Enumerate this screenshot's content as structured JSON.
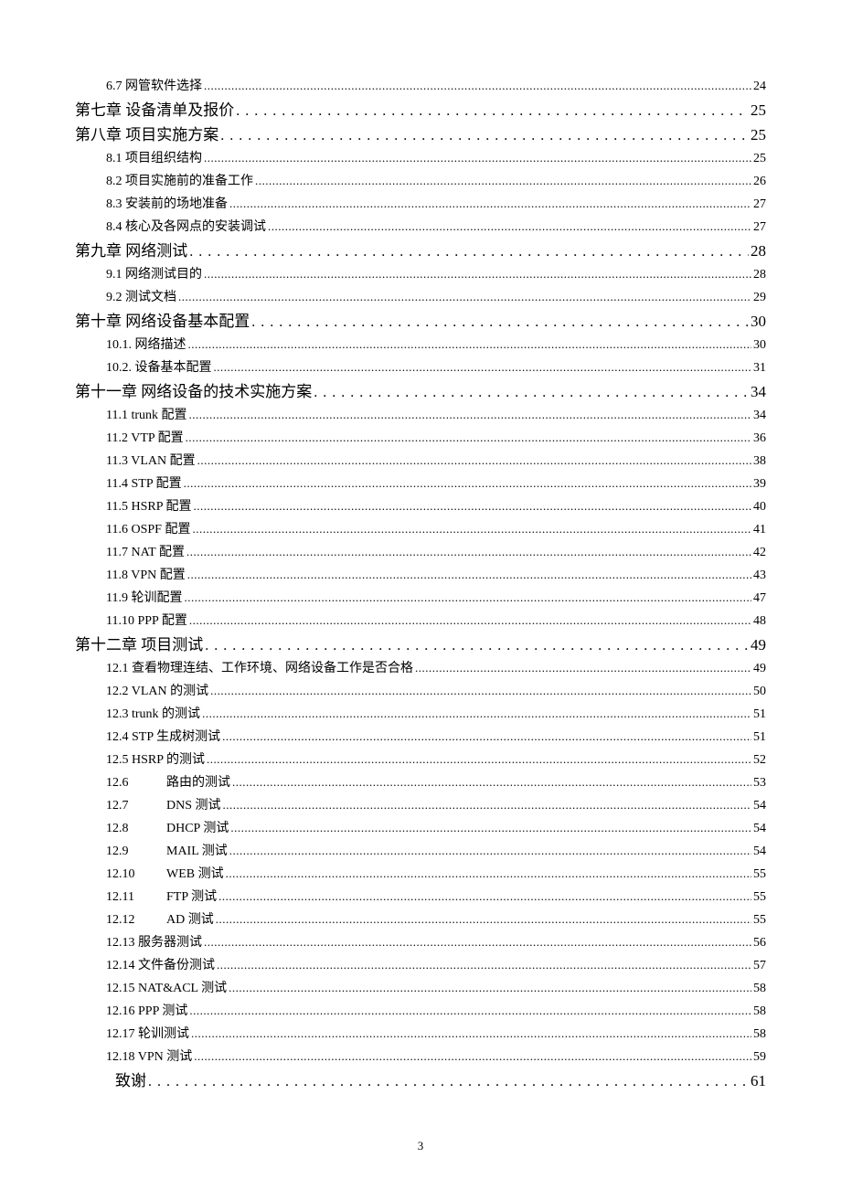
{
  "page_number": "3",
  "toc": [
    {
      "level": 2,
      "label": "6.7 网管软件选择",
      "page": "24"
    },
    {
      "level": 1,
      "label": "第七章 设备清单及报价",
      "page": "25"
    },
    {
      "level": 1,
      "label": "第八章 项目实施方案",
      "page": "25"
    },
    {
      "level": 2,
      "label": "8.1 项目组织结构",
      "page": "25"
    },
    {
      "level": 2,
      "label": "8.2 项目实施前的准备工作",
      "page": "26"
    },
    {
      "level": 2,
      "label": "8.3 安装前的场地准备",
      "page": "27"
    },
    {
      "level": 2,
      "label": "8.4 核心及各网点的安装调试",
      "page": "27"
    },
    {
      "level": 1,
      "label": "第九章 网络测试",
      "page": "28"
    },
    {
      "level": 2,
      "label": "9.1 网络测试目的",
      "page": "28"
    },
    {
      "level": 2,
      "label": "9.2 测试文档",
      "page": "29"
    },
    {
      "level": 1,
      "label": "第十章 网络设备基本配置",
      "page": "30"
    },
    {
      "level": 2,
      "label": "10.1. 网络描述",
      "page": "30"
    },
    {
      "level": 2,
      "label": "10.2. 设备基本配置",
      "page": "31"
    },
    {
      "level": 1,
      "label": "第十一章 网络设备的技术实施方案",
      "page": "34"
    },
    {
      "level": 2,
      "label": "11.1 trunk 配置",
      "page": "34"
    },
    {
      "level": 2,
      "label": "11.2 VTP 配置",
      "page": "36"
    },
    {
      "level": 2,
      "label": "11.3 VLAN 配置",
      "page": "38"
    },
    {
      "level": 2,
      "label": "11.4 STP 配置",
      "page": "39"
    },
    {
      "level": 2,
      "label": "11.5 HSRP 配置",
      "page": "40"
    },
    {
      "level": 2,
      "label": "11.6 OSPF 配置",
      "page": "41"
    },
    {
      "level": 2,
      "label": "11.7 NAT 配置",
      "page": "42"
    },
    {
      "level": 2,
      "label": "11.8 VPN 配置",
      "page": "43"
    },
    {
      "level": 2,
      "label": "11.9 轮训配置",
      "page": "47"
    },
    {
      "level": 2,
      "label": "11.10 PPP 配置",
      "page": "48"
    },
    {
      "level": 1,
      "label": "第十二章 项目测试",
      "page": "49"
    },
    {
      "level": 2,
      "label": "12.1 查看物理连结、工作环境、网络设备工作是否合格",
      "page": "49"
    },
    {
      "level": 2,
      "label": "12.2 VLAN 的测试",
      "page": "50"
    },
    {
      "level": 2,
      "label": "12.3 trunk 的测试",
      "page": "51"
    },
    {
      "level": 2,
      "label": "12.4 STP 生成树测试",
      "page": "51"
    },
    {
      "level": 2,
      "label": "12.5 HSRP 的测试",
      "page": "52"
    },
    {
      "level": 2,
      "pad": true,
      "num": "12.6",
      "rest": "路由的测试",
      "page": "53"
    },
    {
      "level": 2,
      "pad": true,
      "num": "12.7",
      "rest": "DNS 测试",
      "page": "54"
    },
    {
      "level": 2,
      "pad": true,
      "num": "12.8",
      "rest": "DHCP 测试",
      "page": "54"
    },
    {
      "level": 2,
      "pad": true,
      "num": "12.9",
      "rest": "MAIL 测试",
      "page": "54"
    },
    {
      "level": 2,
      "pad": true,
      "num": "12.10",
      "rest": "WEB 测试",
      "page": "55"
    },
    {
      "level": 2,
      "pad": true,
      "num": "12.11",
      "rest": "FTP 测试",
      "page": "55"
    },
    {
      "level": 2,
      "pad": true,
      "num": "12.12",
      "rest": "AD 测试",
      "page": "55"
    },
    {
      "level": 2,
      "label": "12.13 服务器测试",
      "page": "56"
    },
    {
      "level": 2,
      "label": "12.14 文件备份测试",
      "page": "57"
    },
    {
      "level": 2,
      "label": "12.15 NAT&ACL 测试",
      "page": "58"
    },
    {
      "level": 2,
      "label": "12.16 PPP 测试",
      "page": "58"
    },
    {
      "level": 2,
      "label": "12.17 轮训测试",
      "page": "58"
    },
    {
      "level": 2,
      "label": "12.18 VPN 测试",
      "page": "59"
    },
    {
      "level": 3,
      "label": "致谢",
      "page": "61"
    }
  ]
}
